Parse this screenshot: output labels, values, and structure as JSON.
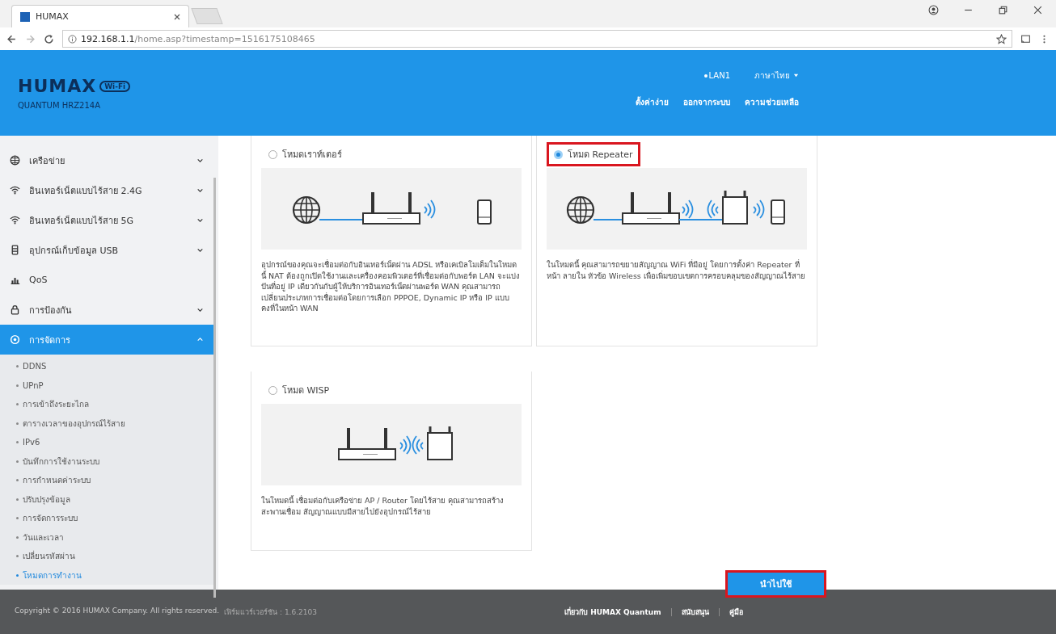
{
  "browser": {
    "tab_title": "HUMAX",
    "url_host": "192.168.1.1",
    "url_path": "/home.asp?timestamp=1516175108465"
  },
  "header": {
    "brand": "HUMAX",
    "badge": "Wi-Fi",
    "model": "QUANTUM HRZ214A",
    "status": "LAN1",
    "language": "ภาษาไทย",
    "nav": [
      "ตั้งค่าง่าย",
      "ออกจากระบบ",
      "ความช่วยเหลือ"
    ]
  },
  "sidebar": {
    "items": [
      {
        "kind": "globe",
        "label": "เครือข่าย",
        "selected": false,
        "expanded": false
      },
      {
        "kind": "wifi",
        "label": "อินเทอร์เน็ตแบบไร้สาย 2.4G",
        "selected": false,
        "expanded": false
      },
      {
        "kind": "wifi",
        "label": "อินเทอร์เน็ตแบบไร้สาย 5G",
        "selected": false,
        "expanded": false
      },
      {
        "kind": "storage",
        "label": "อุปกรณ์เก็บข้อมูล USB",
        "selected": false,
        "expanded": false
      },
      {
        "kind": "chart",
        "label": "QoS",
        "selected": false
      },
      {
        "kind": "lock",
        "label": "การป้องกัน",
        "selected": false,
        "expanded": false
      },
      {
        "kind": "gear",
        "label": "การจัดการ",
        "selected": true,
        "expanded": true,
        "children": [
          {
            "label": "DDNS",
            "selected": false
          },
          {
            "label": "UPnP",
            "selected": false
          },
          {
            "label": "การเข้าถึงระยะไกล",
            "selected": false
          },
          {
            "label": "ตารางเวลาของอุปกรณ์ไร้สาย",
            "selected": false
          },
          {
            "label": "IPv6",
            "selected": false
          },
          {
            "label": "บันทึกการใช้งานระบบ",
            "selected": false
          },
          {
            "label": "การกำหนดค่าระบบ",
            "selected": false
          },
          {
            "label": "ปรับปรุงข้อมูล",
            "selected": false
          },
          {
            "label": "การจัดการระบบ",
            "selected": false
          },
          {
            "label": "วันและเวลา",
            "selected": false
          },
          {
            "label": "เปลี่ยนรหัสผ่าน",
            "selected": false
          },
          {
            "label": "โหมดการทำงาน",
            "selected": true
          }
        ]
      }
    ]
  },
  "modes": [
    {
      "kind": "router",
      "label": "โหมดเราท์เตอร์",
      "selected": false,
      "highlighted": false,
      "description": "อุปกรณ์ของคุณจะเชื่อมต่อกับอินเทอร์เน็ตผ่าน ADSL หรือเคเบิลโมเด็มในโหมดนี้ NAT ต้องถูกเปิดใช้งานและเครื่องคอมพิวเตอร์ที่เชื่อมต่อกับพอร์ต LAN จะแบ่งปันที่อยู่ IP เดียวกันกับผู้ให้บริการอินเทอร์เน็ตผ่านพอร์ต WAN คุณสามารถเปลี่ยนประเภทการเชื่อมต่อโดยการเลือก PPPOE, Dynamic IP หรือ IP แบบคงที่ในหน้า WAN"
    },
    {
      "kind": "repeater",
      "label": "โหมด Repeater",
      "selected": true,
      "highlighted": true,
      "description": "ในโหมดนี้ คุณสามารถขยายสัญญาณ WiFi ที่มีอยู่ โดยการตั้งค่า Repeater ที่หน้า ลายใน หัวข้อ Wireless เพื่อเพิ่มขอบเขตการครอบคลุมของสัญญาณไร้สาย"
    },
    {
      "kind": "wisp",
      "label": "โหมด WISP",
      "selected": false,
      "highlighted": false,
      "description": "ในโหมดนี้ เชื่อมต่อกับเครือข่าย AP / Router โดยไร้สาย คุณสามารถสร้างสะพานเชื่อม สัญญาณแบบมีสายไปยังอุปกรณ์ไร้สาย"
    }
  ],
  "apply_button": {
    "label": "นำไปใช้",
    "highlighted": true
  },
  "footer": {
    "copyright": "Copyright © 2016 HUMAX Company. All rights reserved.",
    "firmware": "เฟิร์มแวร์เวอร์ชัน : 1.6.2103",
    "links": [
      "เกี่ยวกับ HUMAX Quantum",
      "สนับสนุน",
      "คู่มือ"
    ]
  }
}
